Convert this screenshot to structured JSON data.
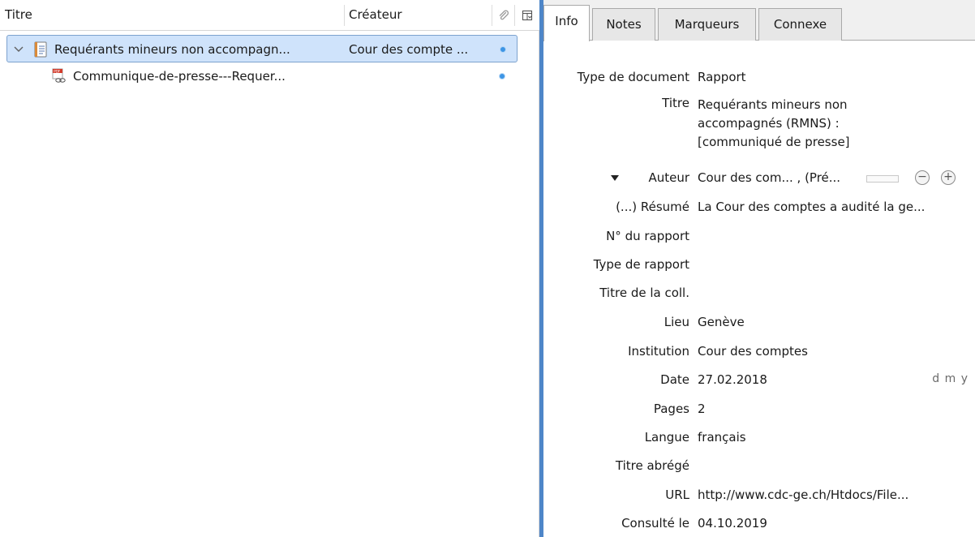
{
  "columns": {
    "title": "Titre",
    "creator": "Créateur"
  },
  "items": [
    {
      "title": "Requérants mineurs non accompagn...",
      "creator": "Cour des compte ...",
      "selected": true,
      "expanded": true
    },
    {
      "title": "Communique-de-presse---Requer...",
      "creator": "",
      "selected": false
    }
  ],
  "tabs": [
    "Info",
    "Notes",
    "Marqueurs",
    "Connexe"
  ],
  "info": {
    "item_type": {
      "label": "Type de document",
      "value": "Rapport"
    },
    "title": {
      "label": "Titre",
      "value": "Requérants mineurs non accompagnés (RMNS) : [communiqué de presse]"
    },
    "author": {
      "label": "Auteur",
      "value": "Cour des com... , (Pré..."
    },
    "abstract": {
      "label": "(...) Résumé",
      "value": "La Cour des comptes a audité la ge..."
    },
    "report_number": {
      "label": "N° du rapport",
      "value": ""
    },
    "report_type": {
      "label": "Type de rapport",
      "value": ""
    },
    "series_title": {
      "label": "Titre de la coll.",
      "value": ""
    },
    "place": {
      "label": "Lieu",
      "value": "Genève"
    },
    "institution": {
      "label": "Institution",
      "value": "Cour des comptes"
    },
    "date": {
      "label": "Date",
      "value": "27.02.2018",
      "format_hint": "d m y"
    },
    "pages": {
      "label": "Pages",
      "value": "2"
    },
    "language": {
      "label": "Langue",
      "value": "français"
    },
    "short_title": {
      "label": "Titre abrégé",
      "value": ""
    },
    "url": {
      "label": "URL",
      "value": "http://www.cdc-ge.ch/Htdocs/File..."
    },
    "accessed": {
      "label": "Consulté le",
      "value": "04.10.2019"
    }
  },
  "colors": {
    "selection": "#cfe3fb",
    "splitter": "#4e86c8",
    "dot": "#3d95e5"
  }
}
